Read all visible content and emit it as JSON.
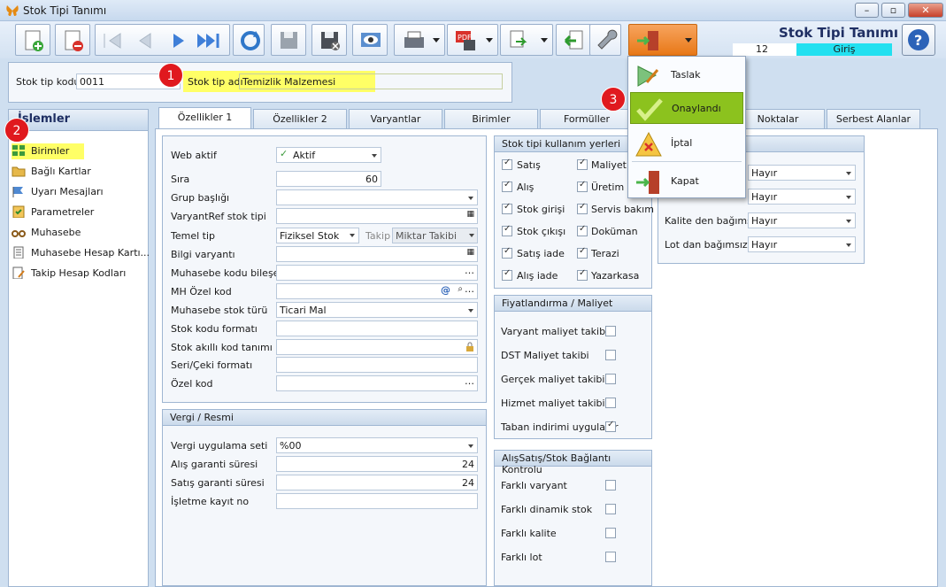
{
  "window": {
    "title": "Stok Tipi Tanımı",
    "min": "–",
    "max": "▫",
    "close": "✕"
  },
  "header": {
    "title": "Stok Tipi Tanımı",
    "status_number": "12",
    "status_label": "Giriş",
    "help": "?"
  },
  "top_fields": {
    "code_label": "Stok tip kodu",
    "code_value": "0011",
    "name_label": "Stok tip adı",
    "name_value": "Temizlik Malzemesi"
  },
  "badges": {
    "b1": "1",
    "b2": "2",
    "b3": "3"
  },
  "sidebar": {
    "title": "İşlemler",
    "items": [
      {
        "label": "Birimler"
      },
      {
        "label": "Bağlı Kartlar"
      },
      {
        "label": "Uyarı Mesajları"
      },
      {
        "label": "Parametreler"
      },
      {
        "label": "Muhasebe"
      },
      {
        "label": "Muhasebe Hesap Kartı..."
      },
      {
        "label": "Takip Hesap Kodları"
      }
    ]
  },
  "tabs": [
    "Özellikler 1",
    "Özellikler 2",
    "Varyantlar",
    "Birimler",
    "Formüller",
    "Noktalar",
    "Serbest Alanlar"
  ],
  "general": {
    "web_aktif_label": "Web aktif",
    "web_aktif_value": "Aktif",
    "sira_label": "Sıra",
    "sira_value": "60",
    "grup_label": "Grup başlığı",
    "varyantref_label": "VaryantRef stok tipi",
    "temel_tip_label": "Temel tip",
    "temel_tip_value": "Fiziksel Stok",
    "takip_label": "Takip",
    "takip_value": "Miktar Takibi",
    "bilgi_label": "Bilgi varyantı",
    "muh_bilesen_label": "Muhasebe kodu bileşeni",
    "mh_ozel_label": "MH Özel kod",
    "muh_stok_turu_label": "Muhasebe stok türü",
    "muh_stok_turu_value": "Ticari Mal",
    "stok_kodu_formati_label": "Stok kodu formatı",
    "akilli_kod_label": "Stok akıllı kod tanımı",
    "seri_cek_label": "Seri/Çeki formatı",
    "ozel_kod_label": "Özel kod"
  },
  "vergi": {
    "title": "Vergi / Resmi",
    "seti_label": "Vergi uygulama seti",
    "seti_value": "%00",
    "alis_label": "Alış garanti süresi",
    "alis_value": "24",
    "satis_label": "Satış garanti süresi",
    "satis_value": "24",
    "isletme_label": "İşletme kayıt no"
  },
  "kullanim": {
    "title": "Stok tipi kullanım yerleri",
    "left": [
      {
        "label": "Satış"
      },
      {
        "label": "Alış"
      },
      {
        "label": "Stok girişi"
      },
      {
        "label": "Stok çıkışı"
      },
      {
        "label": "Satış iade"
      },
      {
        "label": "Alış iade"
      }
    ],
    "right": [
      {
        "label": "Maliyet"
      },
      {
        "label": "Üretim"
      },
      {
        "label": "Servis bakım"
      },
      {
        "label": "Doküman"
      },
      {
        "label": "Terazi"
      },
      {
        "label": "Yazarkasa"
      }
    ]
  },
  "fiyat": {
    "title": "Fiyatlandırma / Maliyet",
    "items": [
      {
        "label": "Varyant maliyet takibi",
        "checked": false
      },
      {
        "label": "DST Maliyet takibi",
        "checked": false
      },
      {
        "label": "Gerçek maliyet takibi",
        "checked": false
      },
      {
        "label": "Hizmet maliyet takibi",
        "checked": false
      },
      {
        "label": "Taban indirimi uygulanır",
        "checked": true
      }
    ]
  },
  "baglanti": {
    "title": "AlışSatış/Stok Bağlantı Kontrolu",
    "items": [
      {
        "label": "Farklı varyant"
      },
      {
        "label": "Farklı dinamik stok"
      },
      {
        "label": "Farklı kalite"
      },
      {
        "label": "Farklı lot"
      }
    ]
  },
  "right_group": {
    "rows": [
      {
        "label": "",
        "value": "Hayır"
      },
      {
        "label": "",
        "value": "Hayır"
      },
      {
        "label": "Kalite den bağımsız",
        "value": "Hayır"
      },
      {
        "label": "Lot dan bağımsız",
        "value": "Hayır"
      }
    ]
  },
  "menu": {
    "items": [
      {
        "label": "Taslak"
      },
      {
        "label": "Onaylandı"
      },
      {
        "label": "İptal"
      },
      {
        "label": "Kapat"
      }
    ]
  },
  "colors": {
    "highlight": "#ffff66",
    "giris_bg": "#22e0f0",
    "menu_active": "#8cc21e",
    "badge": "#e0191e"
  }
}
